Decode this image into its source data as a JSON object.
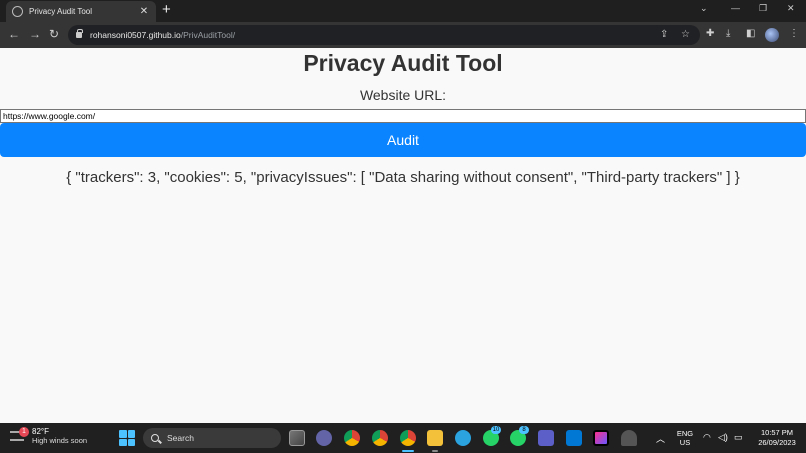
{
  "browser": {
    "tab_title": "Privacy Audit Tool",
    "url_host": "rohansoni0507.github.io",
    "url_path": "/PrivAuditTool/"
  },
  "page": {
    "title": "Privacy Audit Tool",
    "url_label": "Website URL:",
    "url_value": "https://www.google.com/",
    "audit_button": "Audit",
    "result_text": "{ \"trackers\": 3, \"cookies\": 5, \"privacyIssues\": [ \"Data sharing without consent\", \"Third-party trackers\" ] }"
  },
  "taskbar": {
    "weather_badge": "1",
    "weather_temp": "82°F",
    "weather_condition": "High winds soon",
    "search_placeholder": "Search",
    "whatsapp_badge_1": "10",
    "whatsapp_badge_2": "8",
    "language_line1": "ENG",
    "language_line2": "US",
    "time": "10:57 PM",
    "date": "26/09/2023"
  },
  "colors": {
    "audit_button": "#0a84ff",
    "page_background": "#f9f9f9",
    "taskbar_background": "#202020",
    "accent": "#4cc2ff"
  }
}
